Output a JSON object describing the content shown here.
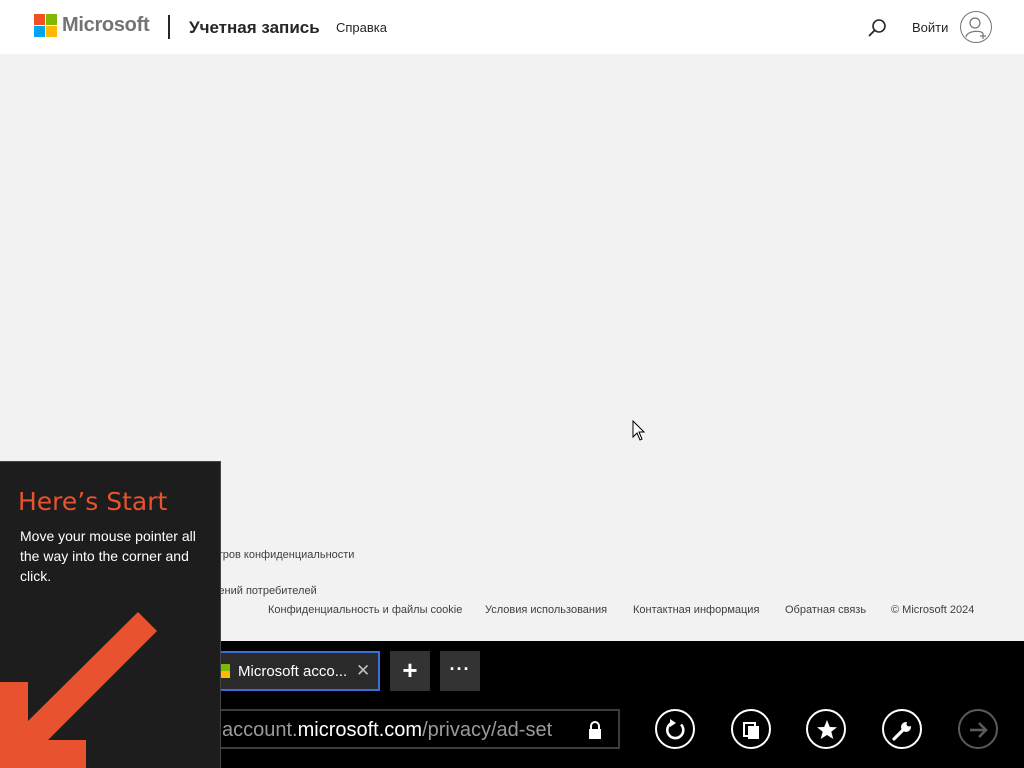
{
  "header": {
    "brand": "Microsoft",
    "title": "Учетная запись",
    "help_link": "Справка",
    "signin": "Войти"
  },
  "footer": {
    "privacy_settings_partial": "етров конфиденциальности",
    "consumer_data_partial": "дений потребителей",
    "links": [
      "Конфиденциальность и файлы cookie",
      "Условия использования",
      "Контактная информация",
      "Обратная связь",
      "© Microsoft 2024"
    ]
  },
  "browser": {
    "tab_title": "Microsoft acco...",
    "tab_close": "✕",
    "new_tab": "+",
    "more": "···",
    "url_prefix": "account.",
    "url_domain": "microsoft.com",
    "url_path": "/privacy/ad-set",
    "buttons": [
      "refresh-icon",
      "copy-page-icon",
      "favorite-star-icon",
      "wrench-icon",
      "forward-arrow-icon"
    ]
  },
  "start_hint": {
    "title": "Here’s Start",
    "description": "Move your mouse pointer all the way into the corner and click."
  },
  "colors": {
    "accent_orange": "#e8522e",
    "tab_border": "#3a6fd8",
    "browser_bg": "#000000",
    "page_bg": "#f2f2f2"
  }
}
